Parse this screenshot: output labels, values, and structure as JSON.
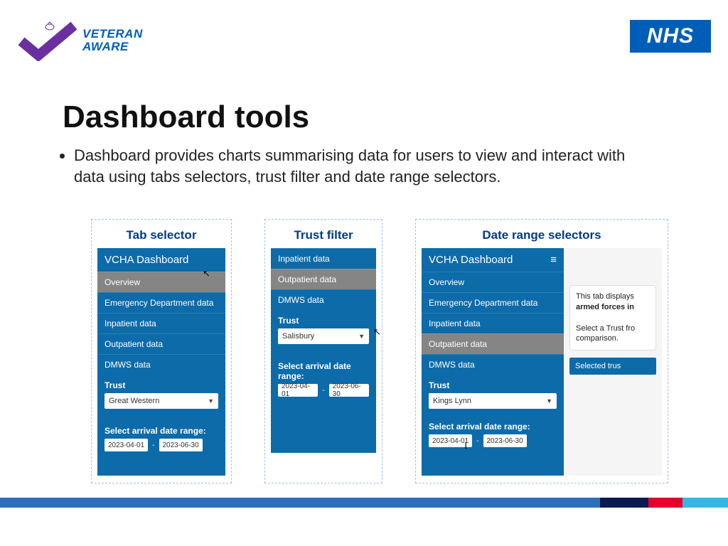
{
  "header": {
    "veteran_line1": "VETERAN",
    "veteran_line2": "AWARE",
    "nhs": "NHS"
  },
  "title": "Dashboard tools",
  "bullet": "Dashboard provides charts summarising data for users to view and interact with data using tabs selectors, trust filter and date range selectors.",
  "panels": {
    "tab_selector": {
      "title": "Tab selector",
      "dash_title": "VCHA Dashboard",
      "tabs": {
        "overview": "Overview",
        "ed": "Emergency Department data",
        "inpatient": "Inpatient data",
        "outpatient": "Outpatient data",
        "dmws": "DMWS data"
      },
      "trust_label": "Trust",
      "trust_value": "Great Western",
      "date_label": "Select arrival date range:",
      "date_from": "2023-04-01",
      "date_sep": "-",
      "date_to": "2023-06-30"
    },
    "trust_filter": {
      "title": "Trust filter",
      "tabs": {
        "inpatient": "Inpatient data",
        "outpatient": "Outpatient data",
        "dmws": "DMWS data"
      },
      "trust_label": "Trust",
      "trust_value": "Salisbury",
      "date_label": "Select arrival date range:",
      "date_from": "2023-04-01",
      "date_sep": "-",
      "date_to": "2023-06-30"
    },
    "date_range": {
      "title": "Date range selectors",
      "dash_title": "VCHA Dashboard",
      "tabs": {
        "overview": "Overview",
        "ed": "Emergency Department data",
        "inpatient": "Inpatient data",
        "outpatient": "Outpatient data",
        "dmws": "DMWS data"
      },
      "trust_label": "Trust",
      "trust_value": "Kings Lynn",
      "date_label": "Select arrival date range:",
      "date_from": "2023-04-01",
      "date_sep": "-",
      "date_to": "2023-06-30",
      "content_text_1": "This tab displays",
      "content_text_2": "armed forces in",
      "content_text_3": "Select a Trust fro",
      "content_text_4": "comparison.",
      "selected_bar": "Selected trus"
    }
  }
}
